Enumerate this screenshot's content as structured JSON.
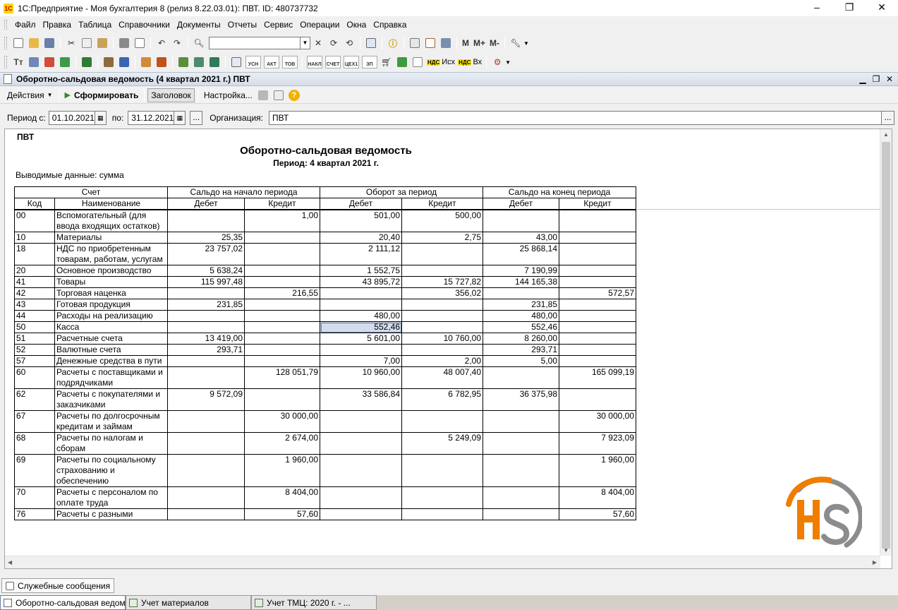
{
  "window": {
    "title": "1С:Предприятие - Моя бухгалтерия 8 (релиз 8.22.03.01): ПВТ. ID: 480737732",
    "icon": "1c-icon",
    "min": "–",
    "max": "❐",
    "close": "✕"
  },
  "menu": [
    "Файл",
    "Правка",
    "Таблица",
    "Справочники",
    "Документы",
    "Отчеты",
    "Сервис",
    "Операции",
    "Окна",
    "Справка"
  ],
  "toolbar": {
    "m": "М",
    "m_plus": "М+",
    "m_minus": "М-",
    "search_value": "",
    "row2_mini": [
      "УСН",
      "АКТ",
      "ТОВ",
      "НАКЛ",
      "СЧЕТ",
      "ЦЕХ1",
      "ЗП"
    ],
    "nds_out": "Исх",
    "nds_in": "Вх",
    "nds_tag": "НДС"
  },
  "doc": {
    "title": "Оборотно-сальдовая ведомость (4 квартал 2021 г.) ПВТ",
    "commands": {
      "actions": "Действия",
      "form": "Сформировать",
      "header": "Заголовок",
      "settings": "Настройка..."
    },
    "params": {
      "period_from_label": "Период с:",
      "period_from": "01.10.2021",
      "period_to_label": "по:",
      "period_to": "31.12.2021",
      "more": "...",
      "org_label": "Организация:",
      "org": "ПВТ",
      "org_btn": "..."
    }
  },
  "report": {
    "org": "ПВТ",
    "title": "Оборотно-сальдовая ведомость",
    "period": "Период: 4 квартал 2021 г.",
    "data_line": "Выводимые данные: сумма",
    "header": {
      "account": "Счет",
      "opening": "Сальдо на начало периода",
      "turnover": "Оборот за период",
      "closing": "Сальдо на конец периода",
      "code": "Код",
      "name": "Наименование",
      "debit": "Дебет",
      "credit": "Кредит"
    },
    "rows": [
      {
        "code": "00",
        "name": "Вспомогательный (для ввода входящих остатков)",
        "od": "",
        "oc": "1,00",
        "td": "501,00",
        "tc": "500,00",
        "cd": "",
        "cc": ""
      },
      {
        "code": "10",
        "name": "Материалы",
        "od": "25,35",
        "oc": "",
        "td": "20,40",
        "tc": "2,75",
        "cd": "43,00",
        "cc": ""
      },
      {
        "code": "18",
        "name": "НДС по приобретенным товарам, работам, услугам",
        "od": "23 757,02",
        "oc": "",
        "td": "2 111,12",
        "tc": "",
        "cd": "25 868,14",
        "cc": ""
      },
      {
        "code": "20",
        "name": "Основное производство",
        "od": "5 638,24",
        "oc": "",
        "td": "1 552,75",
        "tc": "",
        "cd": "7 190,99",
        "cc": ""
      },
      {
        "code": "41",
        "name": "Товары",
        "od": "115 997,48",
        "oc": "",
        "td": "43 895,72",
        "tc": "15 727,82",
        "cd": "144 165,38",
        "cc": ""
      },
      {
        "code": "42",
        "name": "Торговая наценка",
        "od": "",
        "oc": "216,55",
        "td": "",
        "tc": "356,02",
        "cd": "",
        "cc": "572,57"
      },
      {
        "code": "43",
        "name": "Готовая продукция",
        "od": "231,85",
        "oc": "",
        "td": "",
        "tc": "",
        "cd": "231,85",
        "cc": ""
      },
      {
        "code": "44",
        "name": "Расходы на реализацию",
        "od": "",
        "oc": "",
        "td": "480,00",
        "tc": "",
        "cd": "480,00",
        "cc": ""
      },
      {
        "code": "50",
        "name": "Касса",
        "od": "",
        "oc": "",
        "td": "552,46",
        "tc": "",
        "cd": "552,46",
        "cc": ""
      },
      {
        "code": "51",
        "name": "Расчетные счета",
        "od": "13 419,00",
        "oc": "",
        "td": "5 601,00",
        "tc": "10 760,00",
        "cd": "8 260,00",
        "cc": ""
      },
      {
        "code": "52",
        "name": "Валютные счета",
        "od": "293,71",
        "oc": "",
        "td": "",
        "tc": "",
        "cd": "293,71",
        "cc": ""
      },
      {
        "code": "57",
        "name": "Денежные средства в пути",
        "od": "",
        "oc": "",
        "td": "7,00",
        "tc": "2,00",
        "cd": "5,00",
        "cc": ""
      },
      {
        "code": "60",
        "name": "Расчеты с поставщиками и подрядчиками",
        "od": "",
        "oc": "128 051,79",
        "td": "10 960,00",
        "tc": "48 007,40",
        "cd": "",
        "cc": "165 099,19"
      },
      {
        "code": "62",
        "name": "Расчеты с покупателями и заказчиками",
        "od": "9 572,09",
        "oc": "",
        "td": "33 586,84",
        "tc": "6 782,95",
        "cd": "36 375,98",
        "cc": ""
      },
      {
        "code": "67",
        "name": "Расчеты по долгосрочным кредитам и займам",
        "od": "",
        "oc": "30 000,00",
        "td": "",
        "tc": "",
        "cd": "",
        "cc": "30 000,00"
      },
      {
        "code": "68",
        "name": "Расчеты по налогам и сборам",
        "od": "",
        "oc": "2 674,00",
        "td": "",
        "tc": "5 249,09",
        "cd": "",
        "cc": "7 923,09"
      },
      {
        "code": "69",
        "name": "Расчеты по социальному страхованию и обеспечению",
        "od": "",
        "oc": "1 960,00",
        "td": "",
        "tc": "",
        "cd": "",
        "cc": "1 960,00"
      },
      {
        "code": "70",
        "name": "Расчеты с персоналом по оплате труда",
        "od": "",
        "oc": "8 404,00",
        "td": "",
        "tc": "",
        "cd": "",
        "cc": "8 404,00"
      },
      {
        "code": "76",
        "name": "Расчеты с разными",
        "od": "",
        "oc": "57,60",
        "td": "",
        "tc": "",
        "cd": "",
        "cc": "57,60"
      }
    ],
    "selected_row": 8
  },
  "bottom": {
    "service_messages": "Служебные сообщения",
    "tasks": [
      "Оборотно-сальдовая ведом...",
      "Учет материалов",
      "Учет ТМЦ: 2020 г. - ..."
    ]
  },
  "colors": {
    "selection": "#d3dcec",
    "logo_orange": "#f07d00",
    "logo_grey": "#8c8c8c"
  }
}
